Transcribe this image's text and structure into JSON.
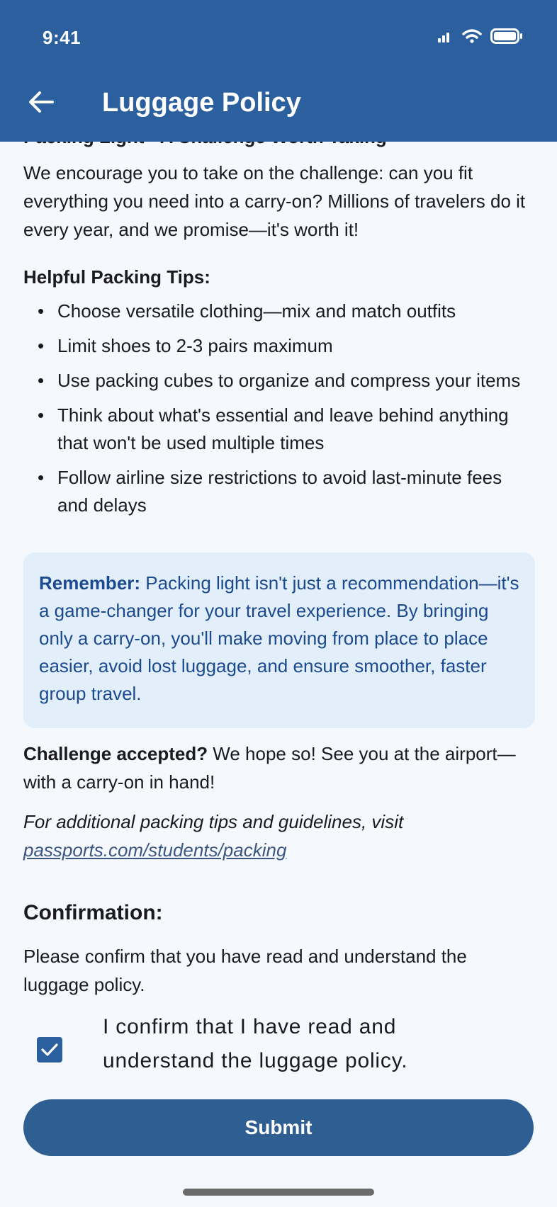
{
  "status_bar": {
    "time": "9:41"
  },
  "header": {
    "title": "Luggage Policy"
  },
  "content": {
    "clipped_heading": "Packing Light - A Challenge Worth Taking",
    "intro": "We encourage you to take on the challenge: can you fit everything you need into a carry-on? Millions of travelers do it every year, and we promise—it's worth it!",
    "tips_title": "Helpful Packing Tips:",
    "tips": [
      "Choose versatile clothing—mix and match outfits",
      "Limit shoes to 2-3 pairs maximum",
      "Use packing cubes to organize and compress your items",
      "Think about what's essential and leave behind anything that won't be used multiple times",
      "Follow airline size restrictions to avoid last-minute fees and delays"
    ],
    "callout": {
      "label": "Remember:",
      "text": " Packing light isn't just a recommendation—it's a game-changer for your travel experience. By bringing only a carry-on, you'll make moving from place to place easier, avoid lost luggage, and ensure smoother, faster group travel."
    },
    "challenge": {
      "label": "Challenge accepted?",
      "text": " We hope so! See you at the airport—with a carry-on in hand!"
    },
    "additional": {
      "text": "For additional packing tips and guidelines, visit ",
      "link": "passports.com/students/packing"
    },
    "confirmation": {
      "title": "Confirmation:",
      "instruction": "Please confirm that you have read and understand the luggage policy.",
      "checkbox_label": "I confirm that I have read and understand the luggage policy.",
      "checked": true
    },
    "submit_label": "Submit"
  },
  "colors": {
    "app_bar": "#2c5f9e",
    "callout_bg": "#e2effb",
    "callout_text": "#1c4a8f",
    "button": "#2f5e92"
  }
}
